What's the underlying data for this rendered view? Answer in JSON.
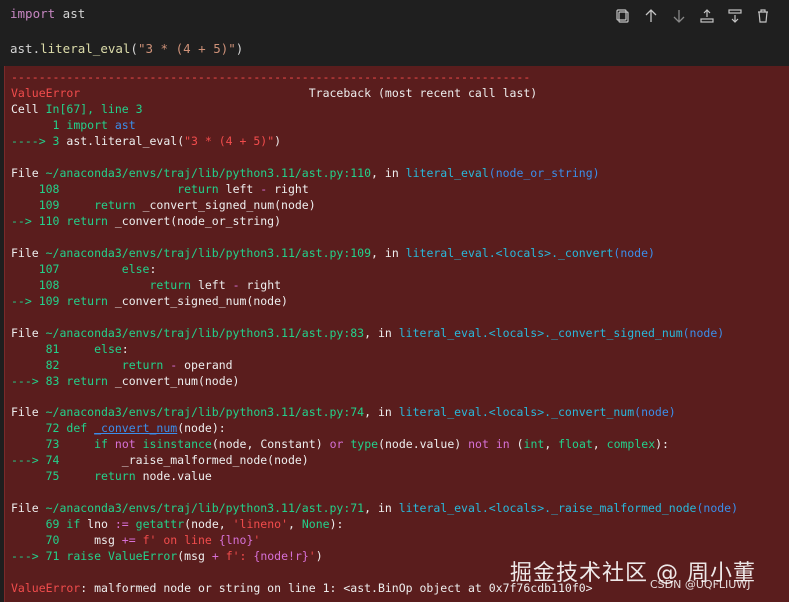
{
  "cell": {
    "line1": {
      "kw": "import",
      "rest": " ast"
    },
    "line2": {
      "obj": "ast",
      "dot": ".",
      "fn": "literal_eval",
      "open": "(",
      "str": "\"3 * (4 + 5)\"",
      "close": ")"
    },
    "toolbar_icons": [
      "copy-icon",
      "arrow-up-icon",
      "arrow-down-icon",
      "insert-above-icon",
      "insert-below-icon",
      "delete-icon"
    ]
  },
  "output": {
    "sep": "---------------------------------------------------------------------------",
    "err_name": "ValueError",
    "traceback_hdr": "Traceback (most recent call last)",
    "cell_loc": {
      "a": "Cell ",
      "b": "In[67], line 3"
    },
    "l_c1": {
      "num": "      1 ",
      "kw": "import",
      "rest": " ast"
    },
    "l_c2": {
      "arrow": "----> 3 ",
      "obj": "ast",
      "dot": ".",
      "fn": "literal_eval(",
      "str": "\"3 * (4 + 5)\"",
      "close": ")"
    },
    "f1": {
      "file": "File ",
      "path": "~/anaconda3/envs/traj/lib/python3.11/ast.py:110",
      "in": ", in ",
      "fn": "literal_eval",
      "args": "(node_or_string)"
    },
    "f1_l1": {
      "num": "    108 ",
      "indent": "                ",
      "kw": "return",
      "rest": " left ",
      "op": "-",
      "rest2": " right"
    },
    "f1_l2": {
      "num": "    109 ",
      "indent": "    ",
      "kw": "return",
      "rest": " _convert_signed_num(node)"
    },
    "f1_l3": {
      "arrow": "--> 110 ",
      "kw": "return",
      "rest": " _convert(node_or_string)"
    },
    "f2": {
      "file": "File ",
      "path": "~/anaconda3/envs/traj/lib/python3.11/ast.py:109",
      "in": ", in ",
      "fn": "literal_eval.<locals>._convert",
      "args": "(node)"
    },
    "f2_l1": {
      "num": "    107 ",
      "indent": "        ",
      "kw": "else",
      "rest": ":"
    },
    "f2_l2": {
      "num": "    108 ",
      "indent": "            ",
      "kw": "return",
      "rest": " left ",
      "op": "-",
      "rest2": " right"
    },
    "f2_l3": {
      "arrow": "--> 109 ",
      "kw": "return",
      "rest": " _convert_signed_num(node)"
    },
    "f3": {
      "file": "File ",
      "path": "~/anaconda3/envs/traj/lib/python3.11/ast.py:83",
      "in": ", in ",
      "fn": "literal_eval.<locals>._convert_signed_num",
      "args": "(node)"
    },
    "f3_l1": {
      "num": "     81 ",
      "indent": "    ",
      "kw": "else",
      "rest": ":"
    },
    "f3_l2": {
      "num": "     82 ",
      "indent": "        ",
      "kw": "return",
      "rest": " ",
      "op": "-",
      "rest2": " operand"
    },
    "f3_l3": {
      "arrow": "---> 83 ",
      "kw": "return",
      "rest": " _convert_num(node)"
    },
    "f4": {
      "file": "File ",
      "path": "~/anaconda3/envs/traj/lib/python3.11/ast.py:74",
      "in": ", in ",
      "fn": "literal_eval.<locals>._convert_num",
      "args": "(node)"
    },
    "f4_l1": {
      "num": "     72 ",
      "kw": "def",
      "sp": " ",
      "fn": "_convert_num",
      "rest": "(node):"
    },
    "f4_l2": {
      "num": "     73 ",
      "indent": "    ",
      "kw": "if",
      "sp": " ",
      "kw2": "not",
      "sp2": " ",
      "fn": "isinstance",
      "r1": "(node, Constant) ",
      "kw3": "or",
      "sp3": " ",
      "fn2": "type",
      "r2": "(node",
      "dot": ".",
      "r3": "value) ",
      "kw4": "not",
      "sp4": " ",
      "kw5": "in",
      "r4": " (",
      "t1": "int",
      "c1": ", ",
      "t2": "float",
      "c2": ", ",
      "t3": "complex",
      "r5": "):"
    },
    "f4_l3": {
      "arrow": "---> 74 ",
      "indent": "        ",
      "rest": "_raise_malformed_node(node)"
    },
    "f4_l4": {
      "num": "     75 ",
      "indent": "    ",
      "kw": "return",
      "rest": " node",
      "dot": ".",
      "rest2": "value"
    },
    "f5": {
      "file": "File ",
      "path": "~/anaconda3/envs/traj/lib/python3.11/ast.py:71",
      "in": ", in ",
      "fn": "literal_eval.<locals>._raise_malformed_node",
      "args": "(node)"
    },
    "f5_l1": {
      "num": "     69 ",
      "kw": "if",
      "rest": " lno ",
      "op": ":=",
      "sp": " ",
      "fn": "getattr",
      "r1": "(node, ",
      "str": "'lineno'",
      "r2": ", ",
      "kw2": "None",
      "r3": "):"
    },
    "f5_l2": {
      "num": "     70 ",
      "indent": "    ",
      "rest": "msg ",
      "op": "+=",
      "sp": " ",
      "str": "f' on line ",
      "brace": "{lno}",
      "str2": "'"
    },
    "f5_l3": {
      "arrow": "---> 71 ",
      "kw": "raise",
      "sp": " ",
      "fn": "ValueError",
      "r1": "(msg ",
      "op": "+",
      "sp2": " ",
      "str": "f': ",
      "brace": "{node!r}",
      "str2": "'",
      "r2": ")"
    },
    "final": {
      "name": "ValueError",
      "msg": ": malformed node or string on line 1: <ast.BinOp object at 0x7f76cdb110f0>"
    }
  },
  "watermark": {
    "main": "掘金技术社区 @ 周小董",
    "small": "CSDN @UQFLIUWJ"
  }
}
